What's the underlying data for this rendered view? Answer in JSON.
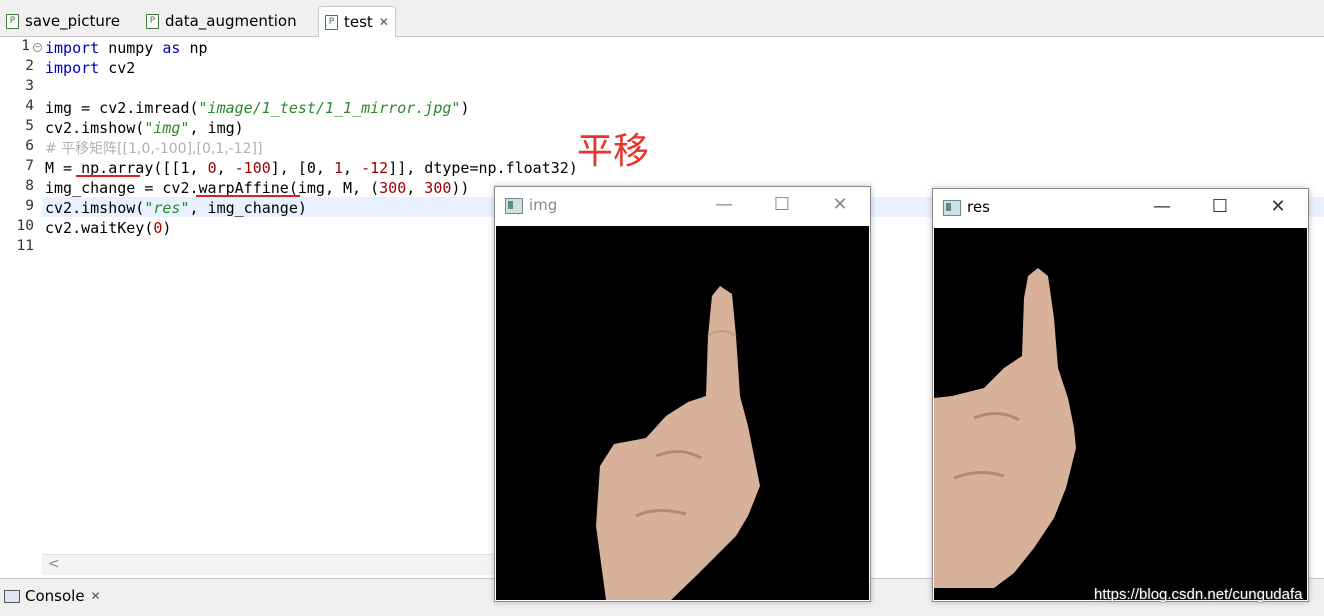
{
  "tabs": [
    {
      "label": "save_picture",
      "icon": "python-file-icon"
    },
    {
      "label": "data_augmention",
      "icon": "python-file-icon"
    },
    {
      "label": "test",
      "icon": "python-file-icon",
      "active": true
    }
  ],
  "editor": {
    "line_numbers": [
      "1",
      "2",
      "3",
      "4",
      "5",
      "6",
      "7",
      "8",
      "9",
      "10",
      "11"
    ],
    "lines": [
      {
        "kw1": "import",
        "rest1": " numpy ",
        "kw2": "as",
        "rest2": " np"
      },
      {
        "kw1": "import",
        "rest1": " cv2"
      },
      {},
      {
        "a": "img = cv2.imread(",
        "s": "\"image/1_test/1_1_mirror.jpg\"",
        "b": ")"
      },
      {
        "a": "cv2.imshow(",
        "s": "\"img\"",
        "b": ", img)"
      },
      {
        "comment": "# 平移矩阵[[1,0,-100],[0,1,-12]]"
      },
      {
        "a": "M = np.array([[1, ",
        "n1": "0",
        "b": ", ",
        "n2": "-100",
        "c": "], [0, ",
        "n3": "1",
        "d": ", ",
        "n4": "-12",
        "e": "]], dtype=np.float32)"
      },
      {
        "a": "img_change = cv2.warpAffine(img, M, (",
        "n1": "300",
        "b": ", ",
        "n2": "300",
        "c": "))"
      },
      {
        "a": "cv2.imshow(",
        "s": "\"res\"",
        "b": ", img_change)"
      },
      {
        "a": "cv2.waitKey(",
        "n1": "0",
        "b": ")"
      },
      {}
    ]
  },
  "annotation": "平移",
  "console_tab": {
    "label": "Console"
  },
  "windows": {
    "img": {
      "title": "img"
    },
    "res": {
      "title": "res"
    }
  },
  "watermark": "https://blog.csdn.net/cungudafa",
  "colors": {
    "keyword": "#0000c0",
    "string": "#2a8a2a",
    "number": "#990000",
    "comment": "#b0b0b0",
    "annotation": "#e8322a"
  }
}
